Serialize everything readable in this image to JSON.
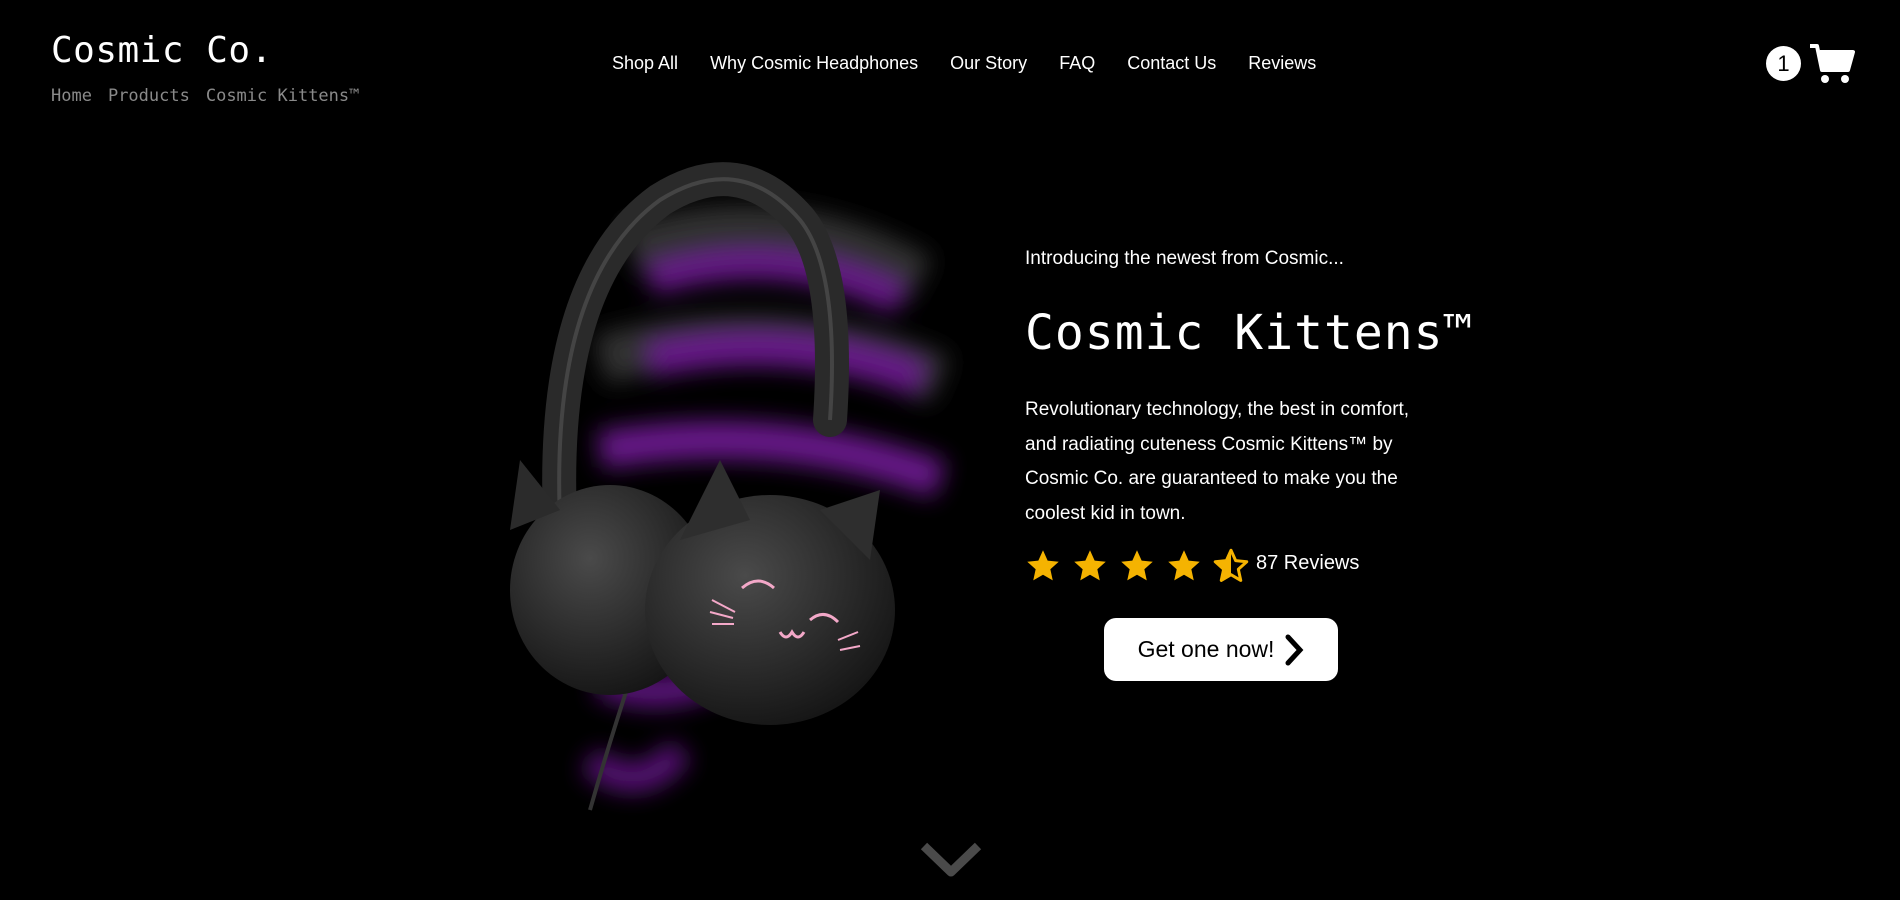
{
  "header": {
    "brand": "Cosmic Co.",
    "breadcrumb": [
      "Home",
      "Products",
      "Cosmic Kittens™"
    ],
    "nav": [
      "Shop All",
      "Why Cosmic Headphones",
      "Our Story",
      "FAQ",
      "Contact Us",
      "Reviews"
    ],
    "cart_count": "1",
    "cart_icon": "shopping-cart-icon"
  },
  "hero": {
    "intro": "Introducing the newest from Cosmic...",
    "title": "Cosmic Kittens™",
    "description": "Revolutionary technology, the best in comfort, and radiating cuteness Cosmic Kittens™ by Cosmic Co. are guaranteed to make you the coolest kid in town.",
    "rating": 4.5,
    "rating_max": 5,
    "review_count": "87 Reviews",
    "cta_label": "Get one now!",
    "cta_icon": "chevron-right-icon",
    "scroll_icon": "chevron-down-icon"
  },
  "colors": {
    "background": "#000000",
    "text": "#ffffff",
    "star": "#f5b301",
    "accent_glow": "#7a1fa2",
    "breadcrumb": "#8a8a8a"
  }
}
